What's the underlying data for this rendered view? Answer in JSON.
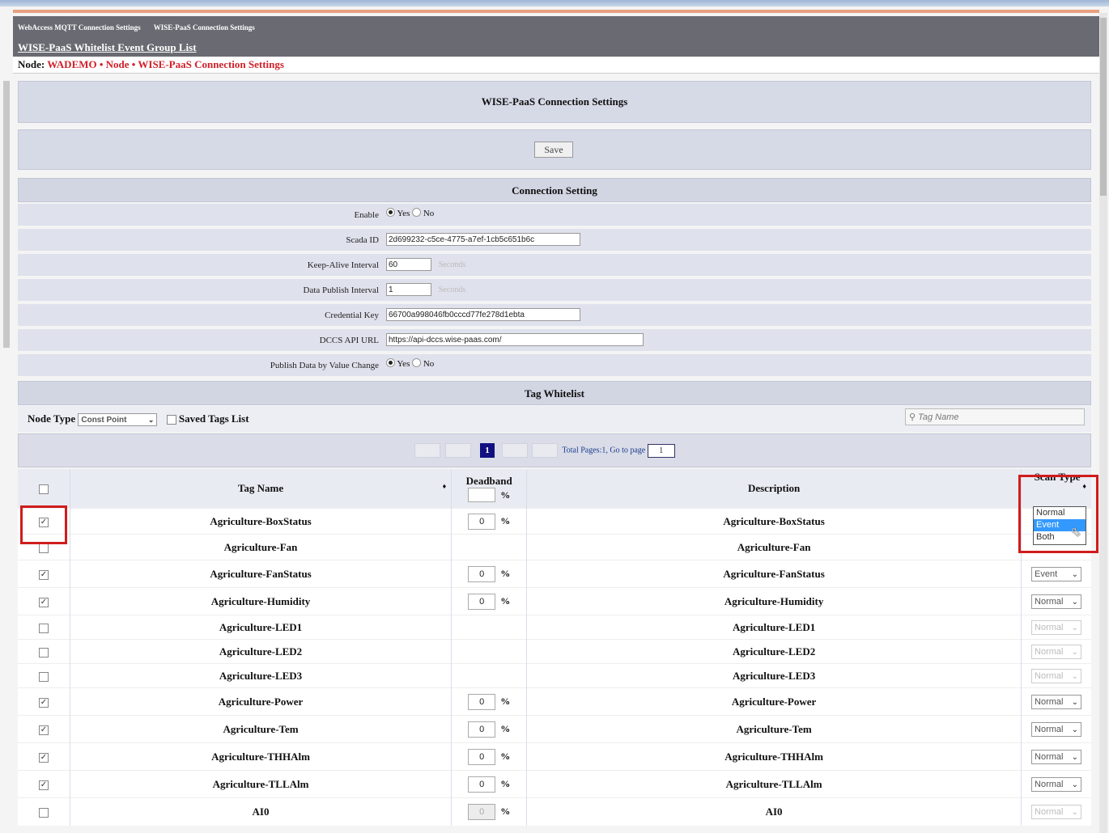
{
  "header": {
    "nav": [
      "WebAccess MQTT Connection Settings",
      "WISE-PaaS Connection Settings"
    ],
    "sublink": "WISE-PaaS Whitelist Event Group List",
    "breadcrumb": {
      "label": "Node:",
      "path": "WADEMO • Node • WISE-PaaS Connection Settings"
    }
  },
  "page_title": "WISE-PaaS Connection Settings",
  "save_label": "Save",
  "connection": {
    "title": "Connection Setting",
    "enable": {
      "label": "Enable",
      "yes": "Yes",
      "no": "No"
    },
    "scada_id": {
      "label": "Scada ID",
      "value": "2d699232-c5ce-4775-a7ef-1cb5c651b6c"
    },
    "keep_alive": {
      "label": "Keep-Alive Interval",
      "value": "60",
      "unit": "Seconds"
    },
    "publish_interval": {
      "label": "Data Publish Interval",
      "value": "1",
      "unit": "Seconds"
    },
    "credential": {
      "label": "Credential Key",
      "value": "66700a998046fb0cccd77fe278d1ebta"
    },
    "dccs": {
      "label": "DCCS API URL",
      "value": "https://api-dccs.wise-paas.com/"
    },
    "publish_change": {
      "label": "Publish Data by Value Change",
      "yes": "Yes",
      "no": "No"
    }
  },
  "whitelist": {
    "title": "Tag Whitelist",
    "node_type_label": "Node Type",
    "node_type_value": "Const Point",
    "saved_tags_label": "Saved Tags List",
    "search_placeholder": "Tag Name",
    "pager": {
      "current": "1",
      "total_text": "Total Pages:1,  Go to page",
      "goto": "1"
    },
    "columns": {
      "tag_name": "Tag Name",
      "deadband": "Deadband",
      "description": "Description",
      "scan_type": "Scan Type"
    },
    "sort_icon": "♦",
    "percent": "%",
    "rows": [
      {
        "checked": true,
        "name": "Agriculture-BoxStatus",
        "deadband": "0",
        "desc": "Agriculture-BoxStatus",
        "scan": "Event",
        "enabled": true
      },
      {
        "checked": false,
        "name": "Agriculture-Fan",
        "deadband": "",
        "desc": "Agriculture-Fan",
        "scan": "",
        "enabled": false
      },
      {
        "checked": true,
        "name": "Agriculture-FanStatus",
        "deadband": "0",
        "desc": "Agriculture-FanStatus",
        "scan": "Event",
        "enabled": true
      },
      {
        "checked": true,
        "name": "Agriculture-Humidity",
        "deadband": "0",
        "desc": "Agriculture-Humidity",
        "scan": "Normal",
        "enabled": true
      },
      {
        "checked": false,
        "name": "Agriculture-LED1",
        "deadband": "",
        "desc": "Agriculture-LED1",
        "scan": "Normal",
        "enabled": false
      },
      {
        "checked": false,
        "name": "Agriculture-LED2",
        "deadband": "",
        "desc": "Agriculture-LED2",
        "scan": "Normal",
        "enabled": false
      },
      {
        "checked": false,
        "name": "Agriculture-LED3",
        "deadband": "",
        "desc": "Agriculture-LED3",
        "scan": "Normal",
        "enabled": false
      },
      {
        "checked": true,
        "name": "Agriculture-Power",
        "deadband": "0",
        "desc": "Agriculture-Power",
        "scan": "Normal",
        "enabled": true
      },
      {
        "checked": true,
        "name": "Agriculture-Tem",
        "deadband": "0",
        "desc": "Agriculture-Tem",
        "scan": "Normal",
        "enabled": true
      },
      {
        "checked": true,
        "name": "Agriculture-THHAlm",
        "deadband": "0",
        "desc": "Agriculture-THHAlm",
        "scan": "Normal",
        "enabled": true
      },
      {
        "checked": true,
        "name": "Agriculture-TLLAlm",
        "deadband": "0",
        "desc": "Agriculture-TLLAlm",
        "scan": "Normal",
        "enabled": true
      },
      {
        "checked": false,
        "name": "AI0",
        "deadband": "0",
        "desc": "AI0",
        "scan": "Normal",
        "enabled": false
      }
    ],
    "scan_options": [
      "Normal",
      "Event",
      "Both"
    ],
    "scan_open_selected": "Event"
  },
  "colors": {
    "highlight": "#d01c1c",
    "panel": "#d6d9e6",
    "header": "#6a6a72",
    "breadcrumb": "#d0202a"
  }
}
